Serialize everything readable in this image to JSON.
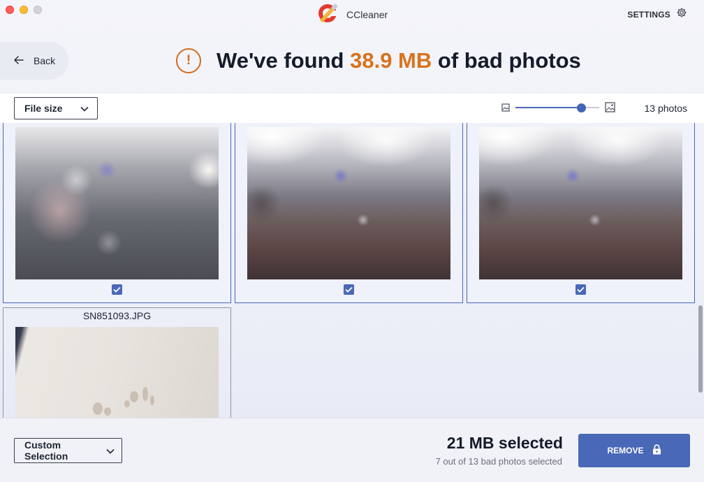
{
  "window": {
    "app_name": "CCleaner",
    "settings_label": "SETTINGS"
  },
  "header": {
    "back_label": "Back",
    "headline_prefix": "We've found ",
    "headline_amount": "38.9 MB",
    "headline_suffix": " of bad photos",
    "accent_color": "#d8731e"
  },
  "toolbar": {
    "sort_value": "File size",
    "zoom_level": 0.78,
    "photo_count": "13 photos"
  },
  "photos": [
    {
      "name": "",
      "selected": true,
      "icon": "blurry-photo"
    },
    {
      "name": "",
      "selected": true,
      "icon": "blurry-photo"
    },
    {
      "name": "",
      "selected": true,
      "icon": "blurry-photo"
    },
    {
      "name": "SN851093.JPG",
      "selected": false,
      "icon": "blurry-photo"
    }
  ],
  "footer": {
    "selection_value": "Custom Selection",
    "selected_size": "21 MB selected",
    "selected_detail": "7 out of 13 bad photos selected",
    "remove_label": "REMOVE",
    "button_color": "#4a68b8"
  }
}
